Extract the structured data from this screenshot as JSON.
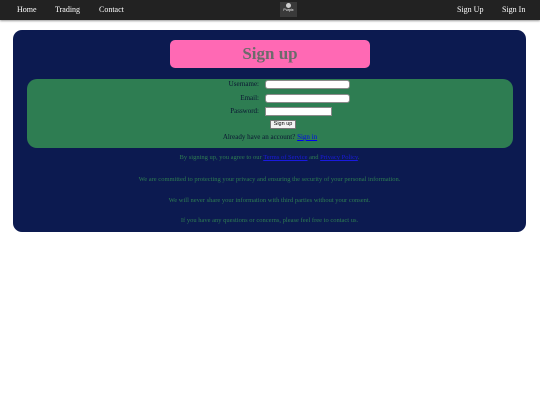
{
  "nav": {
    "home": "Home",
    "trading": "Trading",
    "contact": "Contact",
    "logo_text": "Purpix",
    "sign_up": "Sign Up",
    "sign_in": "Sign In"
  },
  "form": {
    "title": "Sign up",
    "username_label": "Username:",
    "email_label": "Email:",
    "password_label": "Password:",
    "username_value": "",
    "email_value": "",
    "password_value": "",
    "submit_label": "Sign up",
    "already_text": "Already have an account?",
    "sign_in_link": "Sign in"
  },
  "info": {
    "terms_prefix": "By signing up, you agree to our",
    "terms_link": "Terms of Service",
    "terms_and": "and",
    "privacy_link": "Privacy Policy",
    "terms_suffix": ".",
    "privacy_commitment": "We are committed to protecting your privacy and ensuring the security of your personal information.",
    "never_share": "We will never share your information with third parties without your consent.",
    "questions": "If you have any questions or concerns, please feel free to contact us."
  },
  "colors": {
    "nav_bg": "#222222",
    "card_bg": "#0c1a50",
    "title_bg": "#ff69b4",
    "form_bg": "#2e7d52",
    "info_text": "#2e7d52"
  }
}
